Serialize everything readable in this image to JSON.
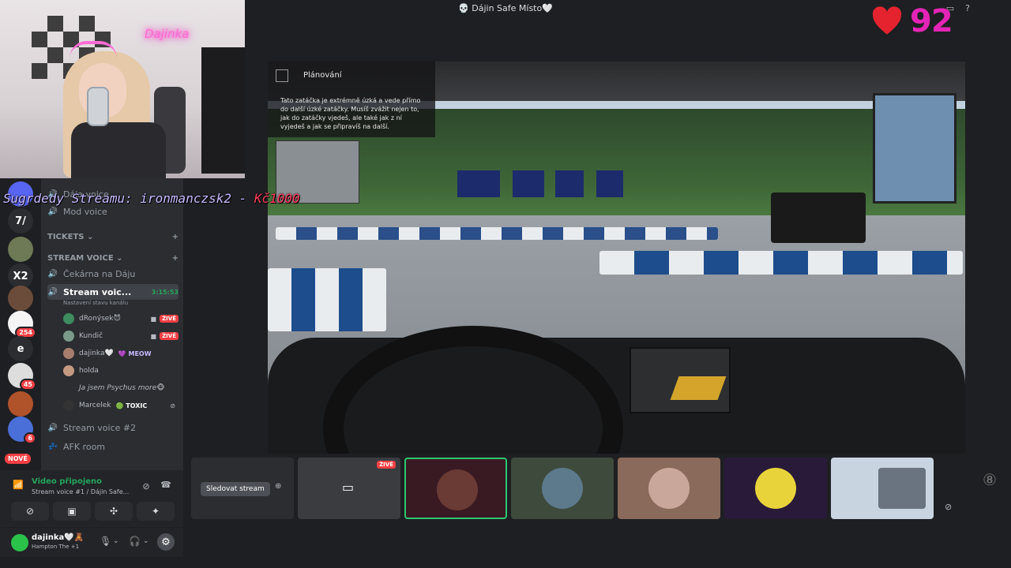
{
  "window": {
    "title": "💀 Dájin Safe Místo🤍"
  },
  "overlay": {
    "neon_sign": "Dajinka",
    "heart_count": "92",
    "sponsor_label": "Sugrdedy Streamu: ironmanczsk2 -",
    "sponsor_amount": "Kč1000"
  },
  "servers": [
    {
      "label": "",
      "color": "#5865f2"
    },
    {
      "label": "7/",
      "color": "#1e1f22"
    },
    {
      "label": "",
      "color": "#6d7a55"
    },
    {
      "label": "X2",
      "color": "#1e1f22"
    },
    {
      "label": "",
      "color": "#6b4c3a"
    },
    {
      "label": "",
      "color": "#f5f5f5",
      "badge": "254"
    },
    {
      "label": "e",
      "color": "#1e1f22"
    },
    {
      "label": "",
      "color": "#ddd",
      "badge": "45"
    },
    {
      "label": "",
      "color": "#b0522a"
    },
    {
      "label": "",
      "color": "#4a6fd8",
      "badge": "6"
    },
    {
      "label": "NOVÉ"
    }
  ],
  "channels": {
    "top_items": [
      "Dája voice",
      "Mod voice"
    ],
    "categories": {
      "tickets": "TICKETS",
      "stream_voice": "STREAM VOICE"
    },
    "waiting": "Čekárna na Dáju",
    "active": {
      "name": "Stream voic...",
      "timer": "3:15:53",
      "sub": "Nastavení stavu kanálu"
    },
    "users": [
      {
        "name": "dRonýsek",
        "emoji": "😈",
        "live": "ŽIVĚ",
        "color": "#3d8b5e"
      },
      {
        "name": "Kundič",
        "live": "ŽIVĚ",
        "color": "#7a9a8a"
      },
      {
        "name": "dajinka",
        "emoji": "🤍",
        "tag": "💜 MEOW",
        "tag_color": "#c9b8ff",
        "color": "#a77e6e"
      },
      {
        "name": "holda",
        "color": "#c49a82"
      },
      {
        "name": "Ja jsem Psychus more",
        "emoji": "🐵",
        "color": "#7a4a8a"
      },
      {
        "name": "Marcelek",
        "tag": "🟢 TOXIC",
        "tag_color": "#ffffff",
        "color": "#333"
      }
    ],
    "stream2": "Stream voice #2",
    "afk": "AFK room"
  },
  "voice_panel": {
    "status": "Video připojeno",
    "sub": "Stream voice #1 / Dájin Safe...",
    "buttons": [
      "camera-off",
      "screen-share",
      "activities",
      "soundboard"
    ]
  },
  "user": {
    "name": "dajinka",
    "emoji": "🤍🧸",
    "status": "Hampton The",
    "status_suffix": "+1"
  },
  "stream": {
    "plan_title": "Plánování",
    "plan_text": "Tato zatáčka je extrémně úzká a vede přímo do další úzké zatáčky. Musíš zvážit nejen to, jak do zatáčky vjedeš, ale také jak z ní vyjedeš a jak se připravíš na další."
  },
  "thumbs": {
    "watch_button": "Sledovat stream",
    "live": "ŽIVĚ"
  },
  "colors": {
    "accent_green": "#23a55a",
    "live_red": "#f23f43",
    "heart_pink": "#e424b6"
  }
}
